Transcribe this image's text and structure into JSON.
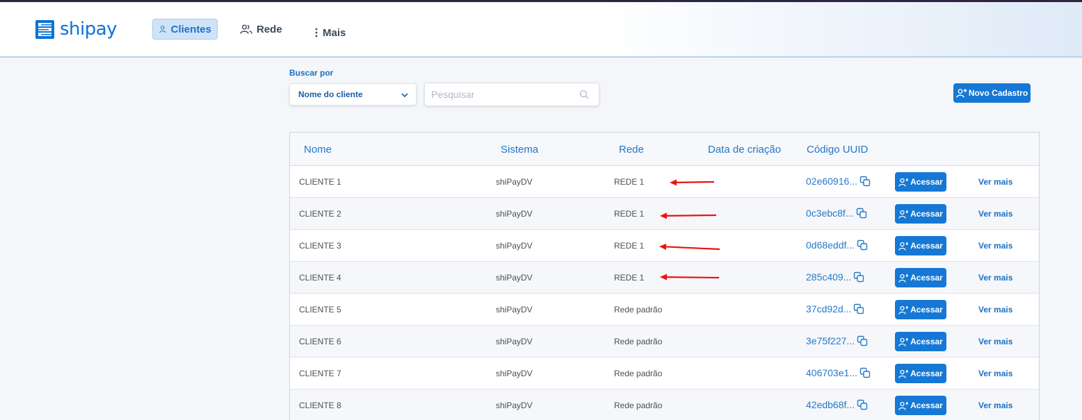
{
  "brand": {
    "name": "shipay",
    "color": "#0b73d8"
  },
  "nav": [
    {
      "label": "Clientes",
      "icon": "user-icon",
      "active": true
    },
    {
      "label": "Rede",
      "icon": "users-icon",
      "active": false
    },
    {
      "label": "Mais",
      "icon": "kebab-icon",
      "active": false
    }
  ],
  "filter": {
    "label": "Buscar por",
    "selected": "Nome do cliente",
    "search_placeholder": "Pesquisar",
    "search_value": ""
  },
  "new_button": {
    "label": "Novo Cadastro",
    "icon": "user-plus-icon"
  },
  "table": {
    "columns": [
      "Nome",
      "Sistema",
      "Rede",
      "Data de criação",
      "Código UUID"
    ],
    "rows": [
      {
        "nome": "CLIENTE 1",
        "sistema": "shiPayDV",
        "rede": "REDE 1",
        "data": "",
        "uuid": "02e60916...",
        "action": "Acessar",
        "more": "Ver mais"
      },
      {
        "nome": "CLIENTE 2",
        "sistema": "shiPayDV",
        "rede": "REDE 1",
        "data": "",
        "uuid": "0c3ebc8f...",
        "action": "Acessar",
        "more": "Ver mais"
      },
      {
        "nome": "CLIENTE 3",
        "sistema": "shiPayDV",
        "rede": "REDE 1",
        "data": "",
        "uuid": "0d68eddf...",
        "action": "Acessar",
        "more": "Ver mais"
      },
      {
        "nome": "CLIENTE 4",
        "sistema": "shiPayDV",
        "rede": "REDE 1",
        "data": "",
        "uuid": "285c409...",
        "action": "Acessar",
        "more": "Ver mais"
      },
      {
        "nome": "CLIENTE 5",
        "sistema": "shiPayDV",
        "rede": "Rede padrão",
        "data": "",
        "uuid": "37cd92d...",
        "action": "Acessar",
        "more": "Ver mais"
      },
      {
        "nome": "CLIENTE 6",
        "sistema": "shiPayDV",
        "rede": "Rede padrão",
        "data": "",
        "uuid": "3e75f227...",
        "action": "Acessar",
        "more": "Ver mais"
      },
      {
        "nome": "CLIENTE 7",
        "sistema": "shiPayDV",
        "rede": "Rede padrão",
        "data": "",
        "uuid": "406703e1...",
        "action": "Acessar",
        "more": "Ver mais"
      },
      {
        "nome": "CLIENTE 8",
        "sistema": "shiPayDV",
        "rede": "Rede padrão",
        "data": "",
        "uuid": "42edb68f...",
        "action": "Acessar",
        "more": "Ver mais"
      }
    ]
  },
  "annotations": {
    "arrow_color": "#e8130f"
  }
}
